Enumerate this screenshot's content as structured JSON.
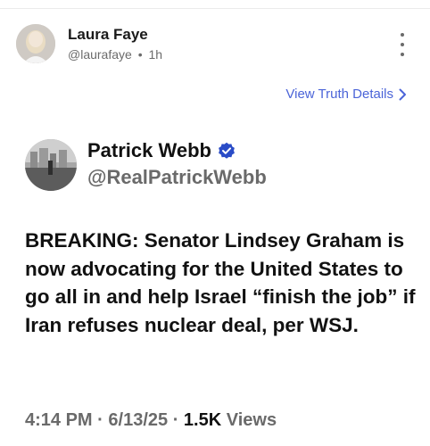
{
  "header": {
    "author_name": "Laura Faye",
    "handle": "@laurafaye",
    "separator": "•",
    "time_ago": "1h"
  },
  "details_link": {
    "label": "View Truth Details"
  },
  "quoted_post": {
    "author_name": "Patrick Webb",
    "handle": "@RealPatrickWebb",
    "verified": true,
    "body": "BREAKING: Senator Lindsey Graham is now advocating for the United States to go all in and help Israel “finish the job” if Iran refuses nuclear deal, per WSJ.",
    "time": "4:14 PM",
    "date": "6/13/25",
    "views_count": "1.5K",
    "views_label": "Views",
    "meta_separator": "·"
  },
  "colors": {
    "link": "#4b64d8",
    "verified_badge": "#2a4cc7",
    "muted_text": "#6a6a6a"
  },
  "icons": {
    "more": "vertical-ellipsis-icon",
    "chevron": "chevron-right-icon",
    "verified": "verified-badge-icon"
  }
}
